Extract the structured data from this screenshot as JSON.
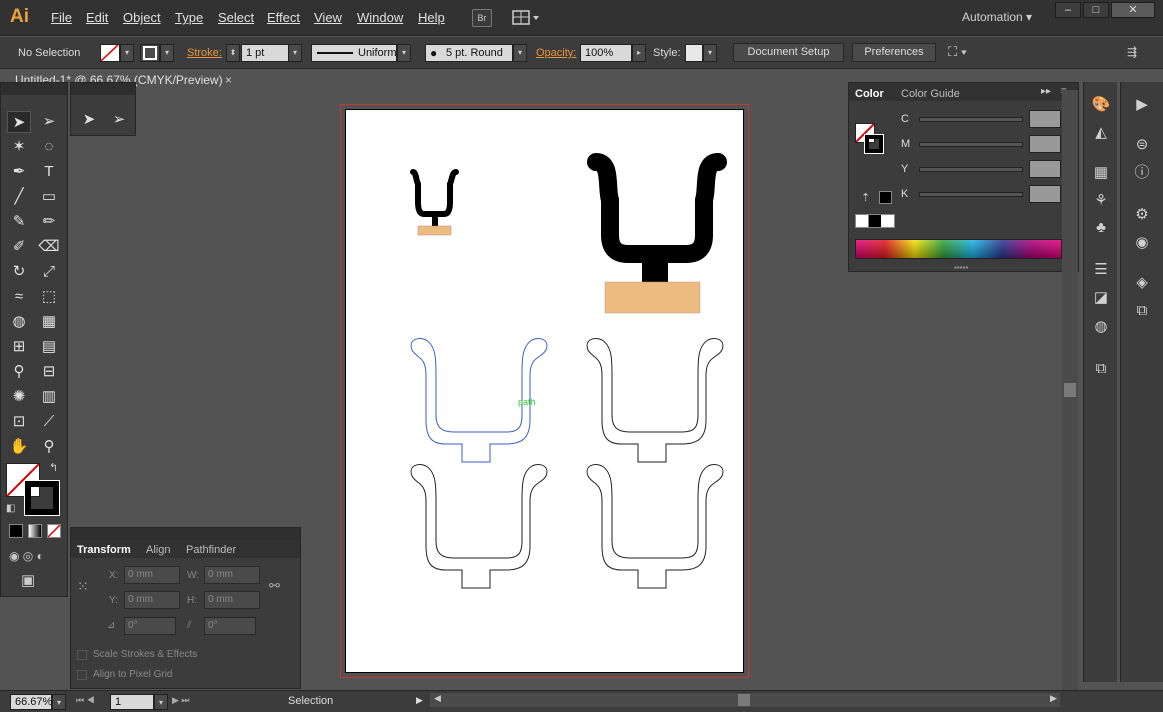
{
  "app": {
    "logo": "Ai",
    "workspace": "Automation",
    "bridge_label": "Br"
  },
  "menu": [
    "File",
    "Edit",
    "Object",
    "Type",
    "Select",
    "Effect",
    "View",
    "Window",
    "Help"
  ],
  "window_buttons": [
    "–",
    "□",
    "✕"
  ],
  "control_bar": {
    "selection": "No Selection",
    "stroke_label": "Stroke:",
    "stroke_value": "1 pt",
    "profile": "Uniform",
    "brush": "5 pt. Round",
    "opacity_label": "Opacity:",
    "opacity_value": "100%",
    "style_label": "Style:",
    "document_setup": "Document Setup",
    "preferences": "Preferences"
  },
  "document_tab": {
    "title": "Untitled-1* @ 66.67% (CMYK/Preview)",
    "close": "×"
  },
  "color_panel": {
    "tabs": [
      "Color",
      "Color Guide"
    ],
    "channels": [
      "C",
      "M",
      "Y",
      "K"
    ],
    "unit": "%"
  },
  "transform_panel": {
    "tabs": [
      "Transform",
      "Align",
      "Pathfinder"
    ],
    "x_label": "X:",
    "x_value": "0 mm",
    "y_label": "Y:",
    "y_value": "0 mm",
    "w_label": "W:",
    "w_value": "0 mm",
    "h_label": "H:",
    "h_value": "0 mm",
    "rotate_value": "0°",
    "shear_value": "0°",
    "scale_strokes": "Scale Strokes & Effects",
    "align_pixel": "Align to Pixel Grid"
  },
  "canvas": {
    "path_hint": "path"
  },
  "status_bar": {
    "zoom": "66.67%",
    "artboard": "1",
    "tool": "Selection"
  },
  "colors": {
    "accent": "#e8a33c",
    "fill_tan": "#ecbb80",
    "selection_blue": "#3a5fc8",
    "bleed_red": "#c0392b"
  }
}
